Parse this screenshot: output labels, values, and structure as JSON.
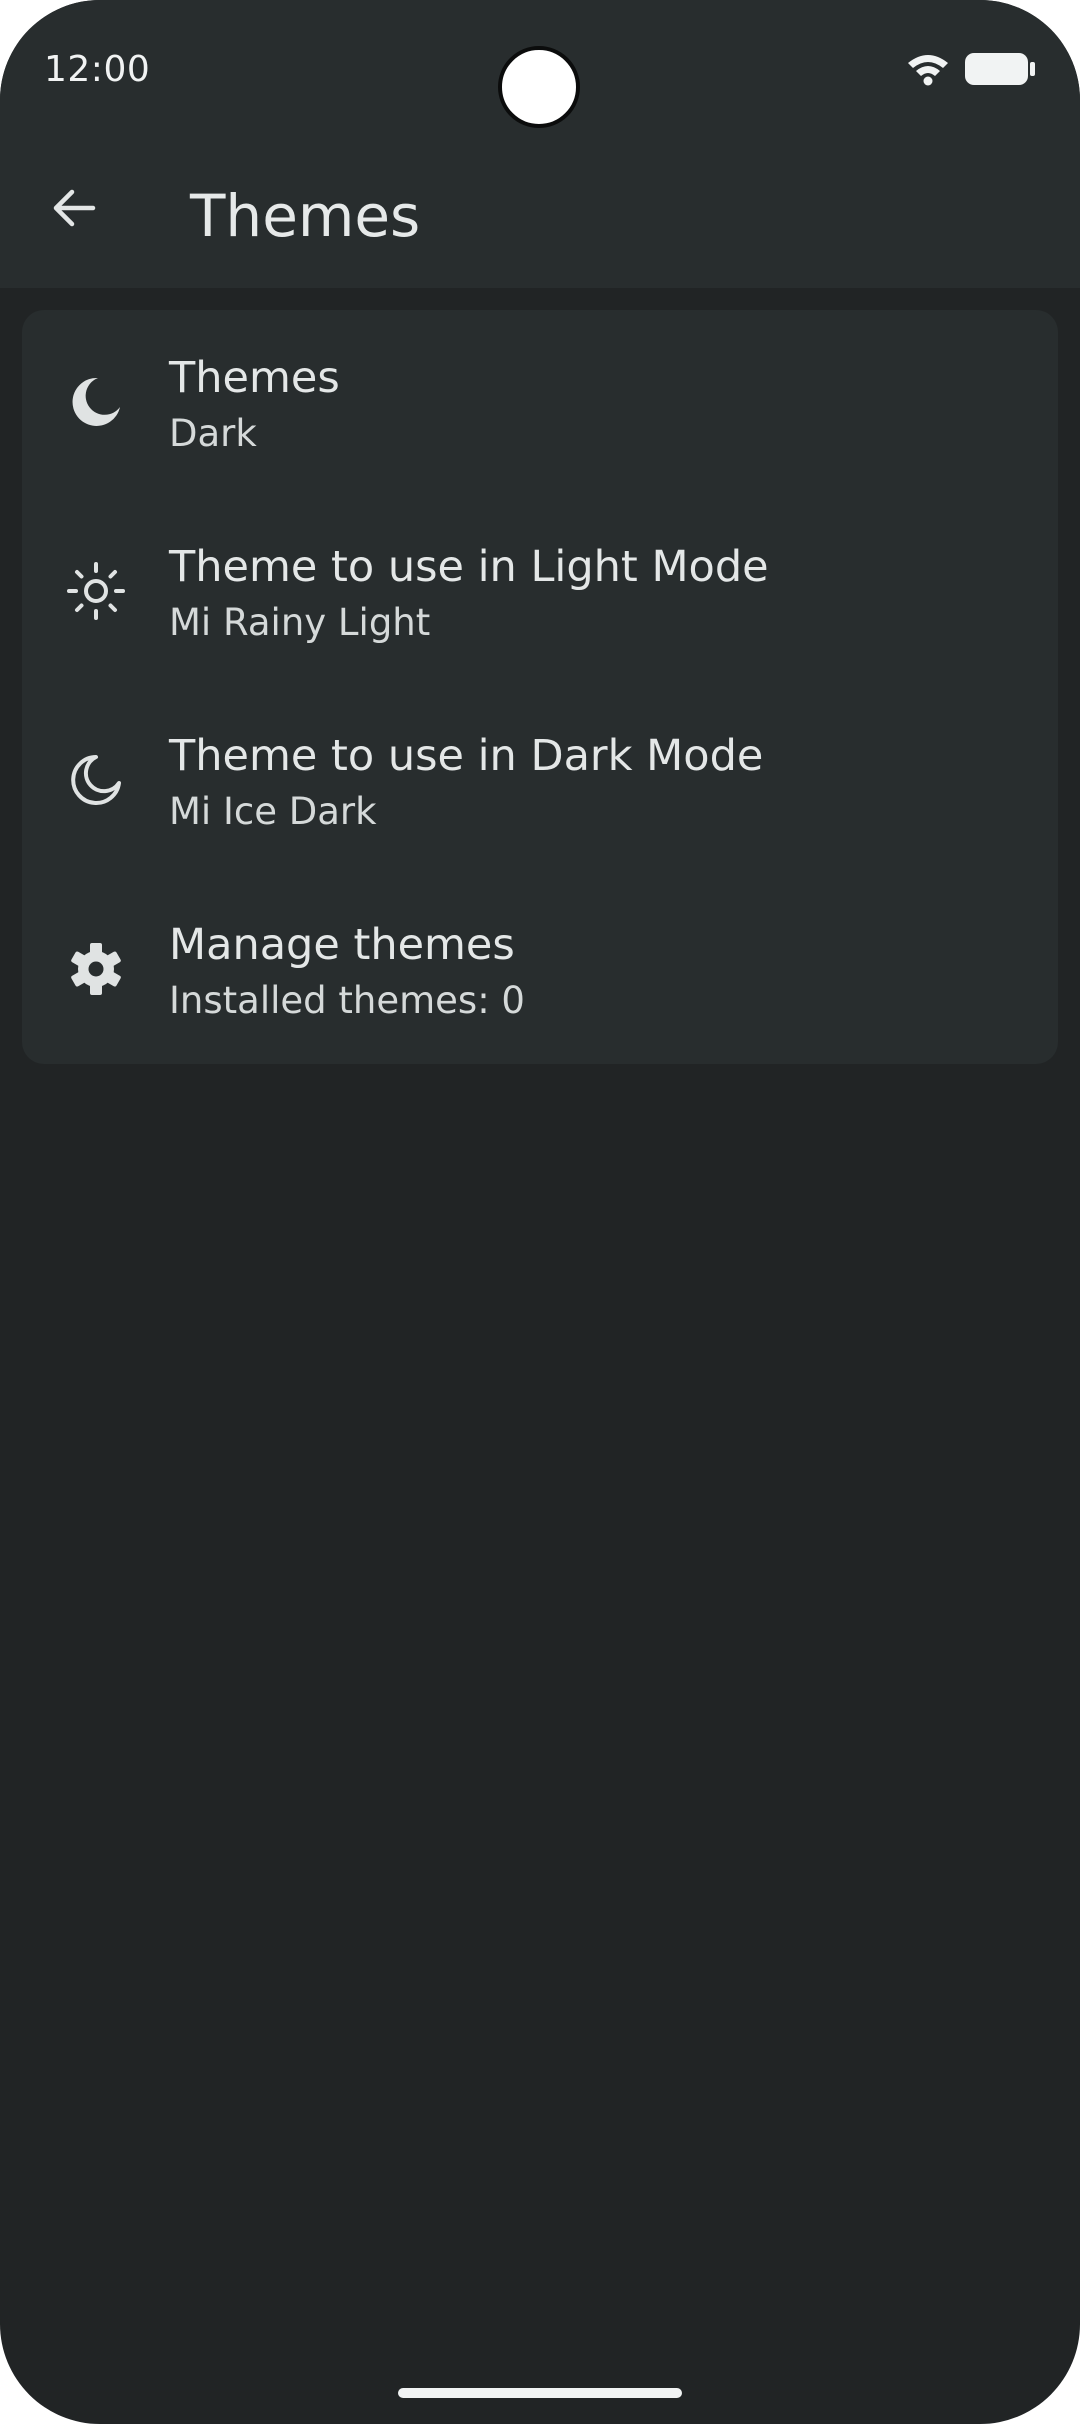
{
  "status_bar": {
    "time": "12:00"
  },
  "app_bar": {
    "title": "Themes",
    "back_icon": "arrow-left-icon"
  },
  "settings": [
    {
      "id": "themes",
      "icon": "crescent-moon-filled-icon",
      "title": "Themes",
      "subtitle": "Dark"
    },
    {
      "id": "light-mode-theme",
      "icon": "sun-icon",
      "title": "Theme to use in Light Mode",
      "subtitle": "Mi Rainy Light"
    },
    {
      "id": "dark-mode-theme",
      "icon": "crescent-moon-outline-icon",
      "title": "Theme to use in Dark Mode",
      "subtitle": "Mi Ice Dark"
    },
    {
      "id": "manage-themes",
      "icon": "gear-icon",
      "title": "Manage themes",
      "subtitle": "Installed themes: 0"
    }
  ],
  "colors": {
    "background": "#212425",
    "surface": "#282d2e",
    "text_primary": "#e4e7e7",
    "text_secondary": "#d5d9d9",
    "icon": "#e0e3e3"
  }
}
